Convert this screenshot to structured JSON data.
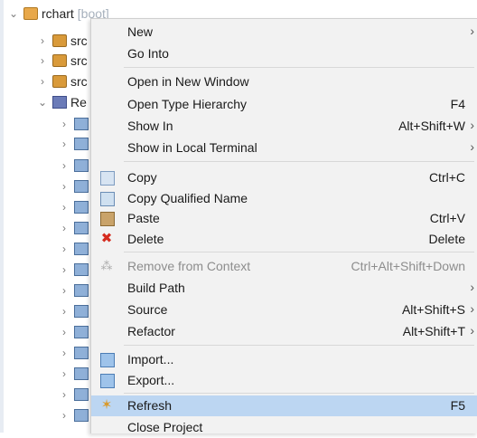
{
  "tree": {
    "root_label": "rchart",
    "root_suffix": "[boot]",
    "source_folders": [
      "src",
      "src",
      "src"
    ],
    "library_label": "Re"
  },
  "menu": {
    "items": [
      {
        "label": "New",
        "shortcut": "",
        "submenu": true
      },
      {
        "label": "Go Into",
        "shortcut": "",
        "submenu": false
      },
      {
        "label": "Open in New Window",
        "shortcut": "",
        "submenu": false
      },
      {
        "label": "Open Type Hierarchy",
        "shortcut": "F4",
        "submenu": false
      },
      {
        "label": "Show In",
        "shortcut": "Alt+Shift+W",
        "submenu": true
      },
      {
        "label": "Show in Local Terminal",
        "shortcut": "",
        "submenu": true
      },
      {
        "label": "Copy",
        "shortcut": "Ctrl+C",
        "submenu": false
      },
      {
        "label": "Copy Qualified Name",
        "shortcut": "",
        "submenu": false
      },
      {
        "label": "Paste",
        "shortcut": "Ctrl+V",
        "submenu": false
      },
      {
        "label": "Delete",
        "shortcut": "Delete",
        "submenu": false
      },
      {
        "label": "Remove from Context",
        "shortcut": "Ctrl+Alt+Shift+Down",
        "submenu": false,
        "disabled": true
      },
      {
        "label": "Build Path",
        "shortcut": "",
        "submenu": true
      },
      {
        "label": "Source",
        "shortcut": "Alt+Shift+S",
        "submenu": true
      },
      {
        "label": "Refactor",
        "shortcut": "Alt+Shift+T",
        "submenu": true
      },
      {
        "label": "Import...",
        "shortcut": "",
        "submenu": false
      },
      {
        "label": "Export...",
        "shortcut": "",
        "submenu": false
      },
      {
        "label": "Refresh",
        "shortcut": "F5",
        "submenu": false,
        "highlighted": true
      },
      {
        "label": "Close Project",
        "shortcut": "",
        "submenu": false
      }
    ],
    "submenu_arrow": "›"
  }
}
